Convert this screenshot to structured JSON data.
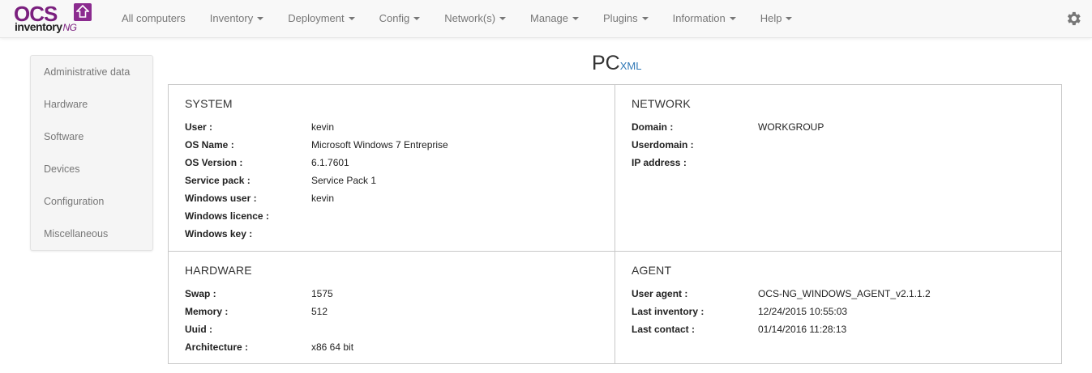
{
  "brand": {
    "logo_text": "OCS",
    "logo_sub": "inventory",
    "logo_sub_suffix": "NG"
  },
  "nav": {
    "items": [
      {
        "label": "All computers",
        "dropdown": false
      },
      {
        "label": "Inventory",
        "dropdown": true
      },
      {
        "label": "Deployment",
        "dropdown": true
      },
      {
        "label": "Config",
        "dropdown": true
      },
      {
        "label": "Network(s)",
        "dropdown": true
      },
      {
        "label": "Manage",
        "dropdown": true
      },
      {
        "label": "Plugins",
        "dropdown": true
      },
      {
        "label": "Information",
        "dropdown": true
      },
      {
        "label": "Help",
        "dropdown": true
      }
    ],
    "settings_icon": "gear-icon"
  },
  "sidebar": {
    "items": [
      {
        "label": "Administrative data"
      },
      {
        "label": "Hardware"
      },
      {
        "label": "Software"
      },
      {
        "label": "Devices"
      },
      {
        "label": "Configuration"
      },
      {
        "label": "Miscellaneous"
      }
    ]
  },
  "page": {
    "title": "PC",
    "xml_link": "XML"
  },
  "panels": {
    "system": {
      "title": "SYSTEM",
      "rows": [
        {
          "key": "User :",
          "value": "kevin"
        },
        {
          "key": "OS Name :",
          "value": "Microsoft Windows 7 Entreprise"
        },
        {
          "key": "OS Version :",
          "value": "6.1.7601"
        },
        {
          "key": "Service pack :",
          "value": "Service Pack 1"
        },
        {
          "key": "Windows user :",
          "value": "kevin"
        },
        {
          "key": "Windows licence :",
          "value": ""
        },
        {
          "key": "Windows key :",
          "value": ""
        }
      ]
    },
    "network": {
      "title": "NETWORK",
      "rows": [
        {
          "key": "Domain :",
          "value": "WORKGROUP"
        },
        {
          "key": "Userdomain :",
          "value": ""
        },
        {
          "key": "IP address :",
          "value": ""
        }
      ]
    },
    "hardware": {
      "title": "HARDWARE",
      "rows": [
        {
          "key": "Swap :",
          "value": "1575"
        },
        {
          "key": "Memory :",
          "value": "512"
        },
        {
          "key": "Uuid :",
          "value": ""
        },
        {
          "key": "Architecture :",
          "value": "x86 64 bit"
        }
      ]
    },
    "agent": {
      "title": "AGENT",
      "rows": [
        {
          "key": "User agent :",
          "value": "OCS-NG_WINDOWS_AGENT_v2.1.1.2"
        },
        {
          "key": "Last inventory :",
          "value": "12/24/2015 10:55:03"
        },
        {
          "key": "Last contact :",
          "value": "01/14/2016 11:28:13"
        }
      ]
    }
  },
  "colors": {
    "brand_purple": "#7a1f7e",
    "link_blue": "#337ab7",
    "nav_text": "#777777"
  }
}
